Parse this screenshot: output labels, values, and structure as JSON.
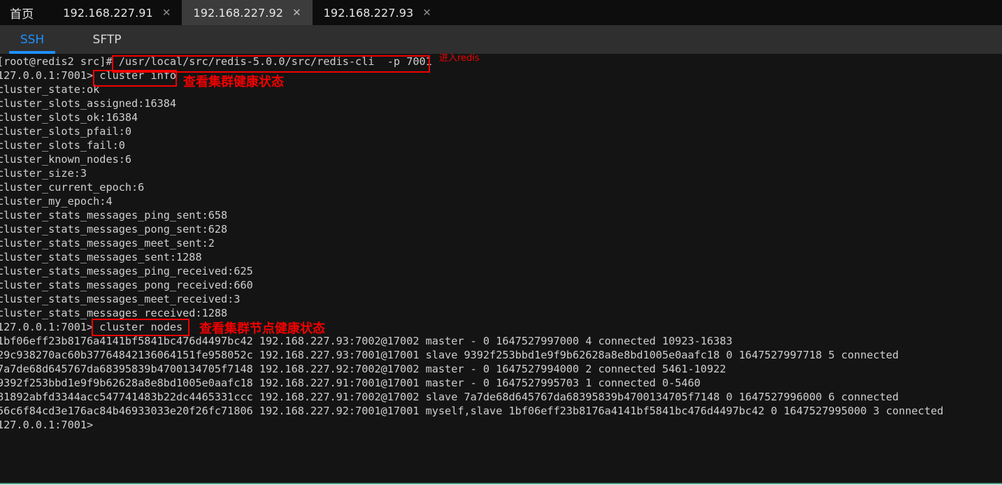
{
  "tabs": [
    {
      "label": "首页",
      "closable": false,
      "active": false
    },
    {
      "label": "192.168.227.91",
      "close": "✕",
      "closable": true,
      "active": false
    },
    {
      "label": "192.168.227.92",
      "close": "✕",
      "closable": true,
      "active": true
    },
    {
      "label": "192.168.227.93",
      "close": "✕",
      "closable": true,
      "active": false
    }
  ],
  "protocols": [
    {
      "label": "SSH",
      "active": true
    },
    {
      "label": "SFTP",
      "active": false
    }
  ],
  "terminal": {
    "lines": [
      "[root@redis2 src]# /usr/local/src/redis-5.0.0/src/redis-cli  -p 7001",
      "127.0.0.1:7001> cluster info",
      "cluster_state:ok",
      "cluster_slots_assigned:16384",
      "cluster_slots_ok:16384",
      "cluster_slots_pfail:0",
      "cluster_slots_fail:0",
      "cluster_known_nodes:6",
      "cluster_size:3",
      "cluster_current_epoch:6",
      "cluster_my_epoch:4",
      "cluster_stats_messages_ping_sent:658",
      "cluster_stats_messages_pong_sent:628",
      "cluster_stats_messages_meet_sent:2",
      "cluster_stats_messages_sent:1288",
      "cluster_stats_messages_ping_received:625",
      "cluster_stats_messages_pong_received:660",
      "cluster_stats_messages_meet_received:3",
      "cluster_stats_messages_received:1288",
      "127.0.0.1:7001> cluster nodes",
      "1bf06eff23b8176a4141bf5841bc476d4497bc42 192.168.227.93:7002@17002 master - 0 1647527997000 4 connected 10923-16383",
      "29c938270ac60b37764842136064151fe958052c 192.168.227.93:7001@17001 slave 9392f253bbd1e9f9b62628a8e8bd1005e0aafc18 0 1647527997718 5 connected",
      "7a7de68d645767da68395839b4700134705f7148 192.168.227.92:7002@17002 master - 0 1647527994000 2 connected 5461-10922",
      "9392f253bbd1e9f9b62628a8e8bd1005e0aafc18 192.168.227.91:7001@17001 master - 0 1647527995703 1 connected 0-5460",
      "81892abfd3344acc547741483b22dc4465331ccc 192.168.227.91:7002@17002 slave 7a7de68d645767da68395839b4700134705f7148 0 1647527996000 6 connected",
      "56c6f84cd3e176ac84b46933033e20f26fc71806 192.168.227.92:7001@17001 myself,slave 1bf06eff23b8176a4141bf5841bc476d4497bc42 0 1647527995000 3 connected",
      "127.0.0.1:7001>"
    ]
  },
  "annotations": [
    {
      "id": "enter-redis",
      "text": "进入redis"
    },
    {
      "id": "cluster-info-note",
      "text": "查看集群健康状态"
    },
    {
      "id": "cluster-nodes-note",
      "text": "查看集群节点健康状态"
    }
  ],
  "colors": {
    "annotation_red": "#f00000",
    "active_protocol_blue": "#1e90ff",
    "terminal_bg": "#141414",
    "terminal_fg": "#cfcfcf",
    "tabbar_bg": "#0d0d0d",
    "active_tab_bg": "#3c3c3c",
    "bottom_accent": "#4a9d85"
  }
}
